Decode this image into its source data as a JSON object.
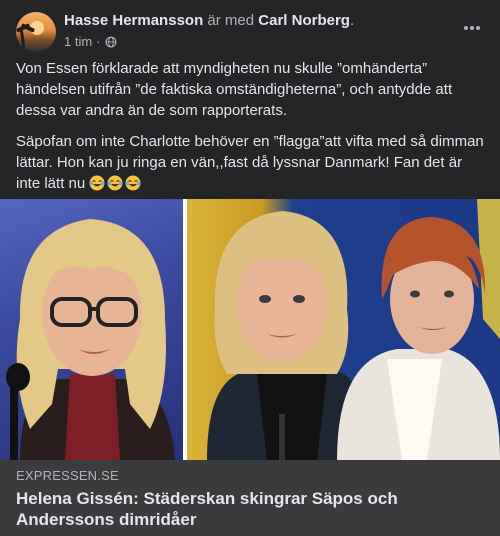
{
  "post": {
    "author": "Hasse Hermansson",
    "with_text": "är med",
    "tagged": "Carl Norberg",
    "period": ".",
    "time": "1 tim",
    "separator": "·",
    "audience_icon": "globe-icon",
    "more_icon": "more-horizontal-icon"
  },
  "body": {
    "paragraph1": "Von Essen förklarade att myndigheten nu skulle ”omhänderta” händelsen utifrån ”de faktiska omständigheterna”, och antydde att dessa var andra än de som rapporterats.",
    "paragraph2": "Säpofan om inte Charlotte behöver en ”flagga”att vifta med så dimman lättar. Hon kan ju ringa en vän,,fast då lyssnar Danmark! Fan det är inte lätt nu",
    "emojis": [
      "face-with-tears-of-joy",
      "face-with-tears-of-joy",
      "face-with-tears-of-joy"
    ]
  },
  "link_preview": {
    "domain": "EXPRESSEN.SE",
    "title": "Helena Gissén: Städerskan skingrar Säpos och Anderssons dimridåer"
  },
  "colors": {
    "background": "#242526",
    "text": "#e4e6eb",
    "muted": "#b0b3b8",
    "link_card": "#3a3b3c"
  }
}
